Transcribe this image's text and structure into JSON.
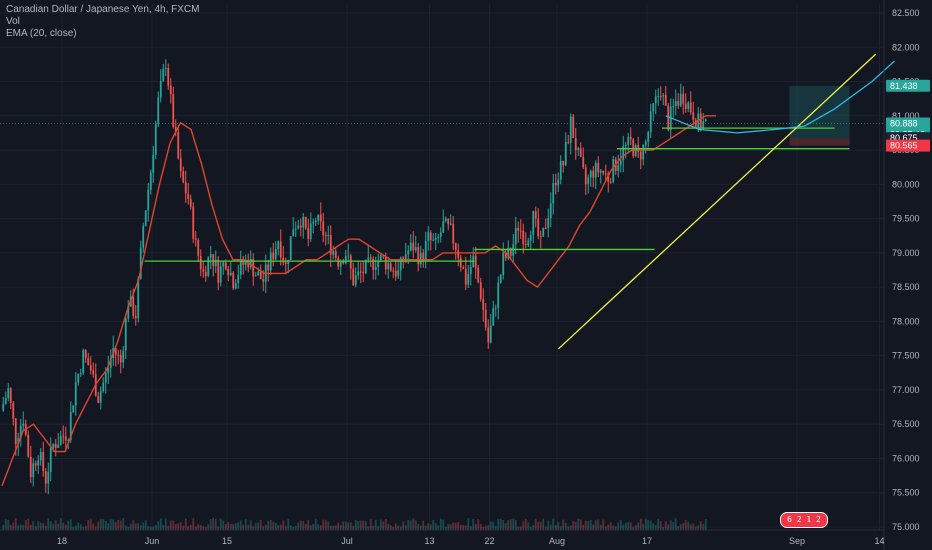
{
  "legend": {
    "title": "Canadian Dollar / Japanese Yen, 4h, FXCM",
    "vol": "Vol",
    "ema": "EMA (20, close)"
  },
  "colors": {
    "background": "#131722",
    "grid": "#1e2230",
    "up": "#26a69a",
    "down": "#ef5350",
    "ema": "#e0442c",
    "trend_lines": "#4cd139",
    "trend_rising": "#f0f04a",
    "curve": "#2bb9e6",
    "price_tag_green": "#26a69a",
    "price_tag_red": "#f23645"
  },
  "chart_data": {
    "type": "candlestick",
    "symbol": "CAD/JPY",
    "timeframe": "4h",
    "source": "FXCM",
    "ylim": [
      75.0,
      82.5
    ],
    "y_ticks": [
      "82.500",
      "82.000",
      "81.500",
      "81.000",
      "80.500",
      "80.000",
      "79.500",
      "79.000",
      "78.500",
      "78.000",
      "77.500",
      "77.000",
      "76.500",
      "76.000",
      "75.500",
      "75.000"
    ],
    "x_ticks": [
      "18",
      "Jun",
      "15",
      "Jul",
      "13",
      "22",
      "Aug",
      "17",
      "Sep",
      "14"
    ],
    "x_tick_index": [
      8,
      20,
      30,
      46,
      57,
      65,
      74,
      86,
      106,
      117
    ],
    "close_path": [
      76.7,
      77.0,
      76.3,
      76.6,
      75.8,
      76.1,
      75.7,
      76.2,
      76.3,
      76.4,
      77.1,
      77.5,
      77.3,
      76.9,
      77.2,
      77.6,
      77.4,
      78.3,
      78.1,
      79.4,
      80.2,
      81.2,
      81.8,
      80.9,
      80.1,
      79.8,
      79.1,
      78.7,
      79.0,
      78.7,
      78.9,
      78.6,
      78.8,
      78.9,
      78.7,
      78.6,
      78.9,
      79.2,
      78.8,
      79.4,
      79.5,
      79.2,
      79.5,
      79.3,
      79.1,
      78.9,
      79.0,
      78.6,
      78.7,
      78.8,
      78.9,
      78.9,
      78.8,
      78.7,
      79.0,
      79.1,
      78.9,
      79.2,
      79.1,
      79.4,
      79.3,
      79.0,
      78.6,
      78.9,
      78.4,
      77.7,
      78.3,
      78.9,
      79.0,
      79.4,
      79.2,
      79.5,
      79.1,
      79.6,
      80.1,
      80.3,
      80.9,
      80.4,
      80.0,
      80.2,
      80.2,
      80.1,
      80.3,
      80.5,
      80.6,
      80.4,
      80.6,
      81.1,
      81.4,
      80.9,
      81.2,
      81.3,
      81.1,
      80.9,
      80.888
    ],
    "ema_path": [
      75.6,
      76.0,
      76.4,
      76.5,
      76.3,
      76.1,
      76.1,
      76.5,
      76.8,
      77.1,
      77.3,
      77.7,
      78.2,
      78.6,
      79.3,
      80.0,
      80.6,
      80.9,
      80.8,
      80.3,
      79.7,
      79.2,
      78.9,
      78.9,
      78.8,
      78.7,
      78.7,
      78.7,
      78.8,
      78.9,
      78.9,
      79.0,
      79.1,
      79.2,
      79.2,
      79.1,
      79.0,
      78.9,
      78.9,
      78.9,
      78.9,
      78.9,
      79.0,
      79.0,
      79.0,
      79.0,
      79.0,
      79.1,
      79.0,
      78.8,
      78.6,
      78.5,
      78.7,
      78.9,
      79.1,
      79.4,
      79.6,
      79.9,
      80.2,
      80.4,
      80.5,
      80.5,
      80.5,
      80.6,
      80.7,
      80.8,
      80.9,
      81.0,
      81.0
    ],
    "ema_start_index": 0,
    "horizontal_levels": [
      {
        "y": 78.88,
        "from_index": 19,
        "to_index": 63
      },
      {
        "y": 79.05,
        "from_index": 63,
        "to_index": 87
      },
      {
        "y": 80.82,
        "from_index": 88,
        "to_index": 111
      },
      {
        "y": 80.52,
        "from_index": 82,
        "to_index": 113
      }
    ],
    "trendline": {
      "from": [
        74.2,
        77.6
      ],
      "to": [
        116.5,
        81.9
      ]
    },
    "curve": [
      [
        88.5,
        81.0
      ],
      [
        93,
        80.8
      ],
      [
        98,
        80.75
      ],
      [
        103,
        80.8
      ],
      [
        107,
        80.85
      ],
      [
        111,
        81.1
      ],
      [
        116,
        81.5
      ],
      [
        119,
        81.8
      ]
    ],
    "position_box": {
      "from_index": 105,
      "to_index": 113,
      "top": 81.438,
      "entry": 80.675,
      "bottom": 80.565
    },
    "last_price": 80.888,
    "price_tags": [
      {
        "value": "81.438",
        "y": 81.438,
        "color": "#26a69a"
      },
      {
        "value": "80.888",
        "y": 80.888,
        "color": "#26a69a"
      },
      {
        "value": "03:35:46",
        "y": 80.73,
        "color": "#26a69a"
      },
      {
        "value": "80.675",
        "y": 80.675,
        "color": "#1f2230"
      },
      {
        "value": "80.565",
        "y": 80.565,
        "color": "#f23645"
      }
    ]
  },
  "badge_text": "6 2 1 2"
}
